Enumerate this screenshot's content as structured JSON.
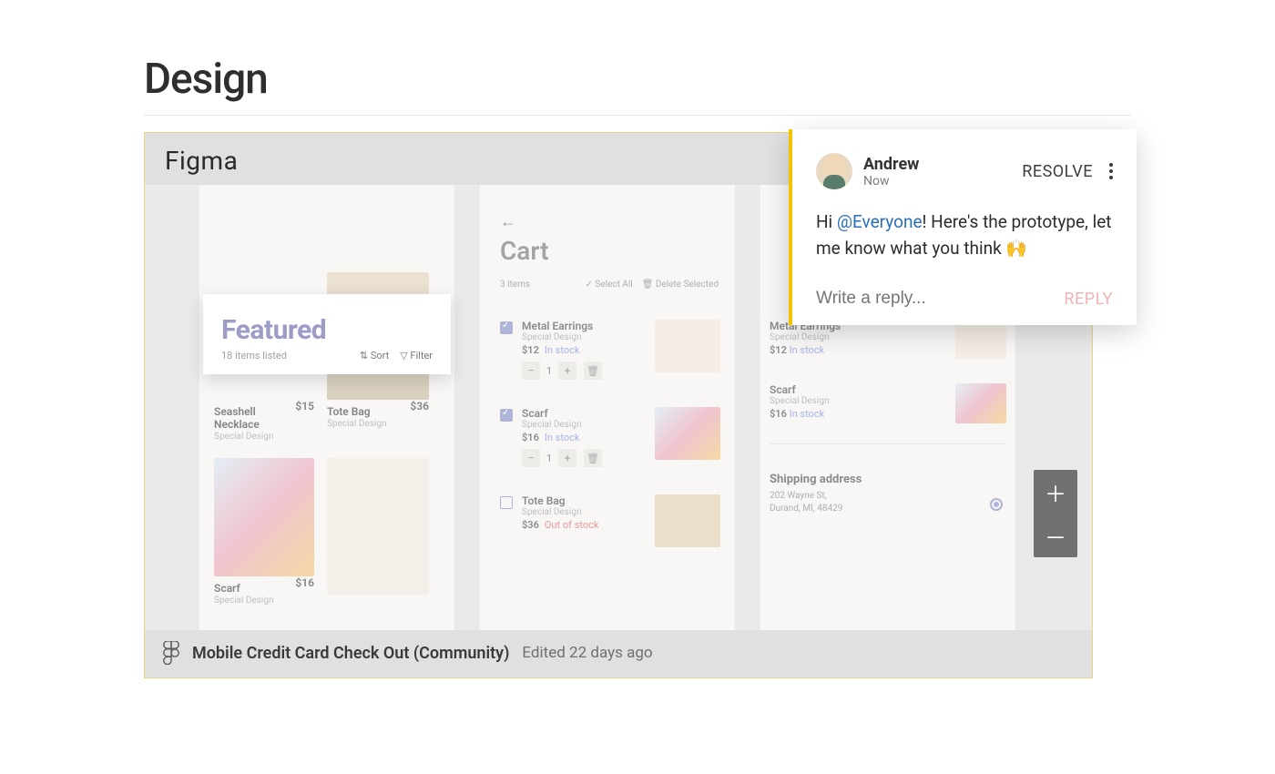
{
  "page": {
    "title": "Design"
  },
  "embed": {
    "header": "Figma",
    "footer": {
      "name": "Mobile Credit Card Check Out (Community)",
      "meta": "Edited 22 days ago"
    },
    "zoom": {
      "in": "＋",
      "out": "－"
    }
  },
  "featured": {
    "title": "Featured",
    "subtitle": "18 items listed",
    "sort": "⇅ Sort",
    "filter": "▽ Filter"
  },
  "products": {
    "seashell": {
      "name": "Seashell Necklace",
      "sub": "Special Design",
      "price": "$15"
    },
    "tote": {
      "name": "Tote Bag",
      "sub": "Special Design",
      "price": "$36"
    },
    "scarf": {
      "name": "Scarf",
      "sub": "Special Design",
      "price": "$16"
    }
  },
  "cart": {
    "title": "Cart",
    "count": "3 items",
    "selectAll": "✓ Select All",
    "deleteSelected": "🗑 Delete Selected",
    "items": [
      {
        "name": "Metal Earrings",
        "sub": "Special Design",
        "price": "$12",
        "stock": "In stock",
        "qty": "1",
        "checked": true
      },
      {
        "name": "Scarf",
        "sub": "Special Design",
        "price": "$16",
        "stock": "In stock",
        "qty": "1",
        "checked": true
      },
      {
        "name": "Tote Bag",
        "sub": "Special Design",
        "price": "$36",
        "stock": "Out of stock",
        "qty": "",
        "checked": false
      }
    ]
  },
  "right": {
    "items": [
      {
        "name": "Metal Earrings",
        "sub": "Special Design",
        "price": "$12",
        "stock": "In stock"
      },
      {
        "name": "Scarf",
        "sub": "Special Design",
        "price": "$16",
        "stock": "In stock"
      }
    ],
    "shipping": {
      "title": "Shipping address",
      "line1": "202 Wayne St,",
      "line2": "Durand, MI, 48429"
    }
  },
  "comment": {
    "user": "Andrew",
    "time": "Now",
    "resolve": "RESOLVE",
    "body_pre": "Hi ",
    "mention": "@Everyone",
    "body_post": "! Here's the prototype, let me know what you think 🙌",
    "reply_placeholder": "Write a reply...",
    "reply_btn": "REPLY"
  }
}
